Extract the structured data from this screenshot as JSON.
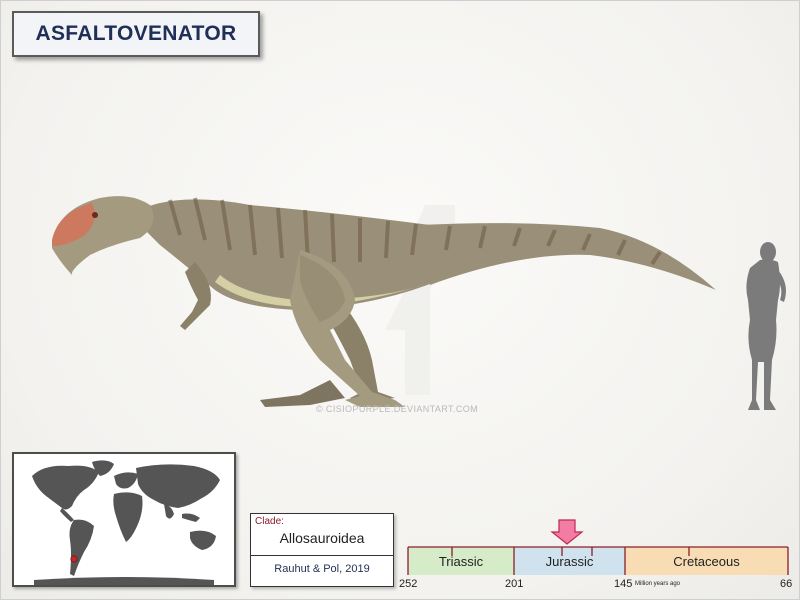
{
  "title": "ASFALTOVENATOR",
  "watermark": "© CISIOPURPLE.DEVIANTART.COM",
  "clade": {
    "label": "Clade:",
    "name": "Allosauroidea",
    "author": "Rauhut & Pol, 2019"
  },
  "timeline": {
    "periods": [
      {
        "name": "Triassic",
        "color": "#d6ecc8"
      },
      {
        "name": "Jurassic",
        "color": "#cfe2ee"
      },
      {
        "name": "Cretaceous",
        "color": "#f8dcb4"
      }
    ],
    "ticks": [
      "252",
      "201",
      "145",
      "66"
    ],
    "unit": "Million years ago",
    "marker_color": "#f27ca3"
  },
  "colors": {
    "body": "#9a9079",
    "stripes": "#6f5f47",
    "belly": "#d4cfa4",
    "snout": "#d4735a",
    "human": "#7b7b7b",
    "land": "#555555",
    "location": "#c0282b",
    "frame_border": "#5a5a5a"
  }
}
